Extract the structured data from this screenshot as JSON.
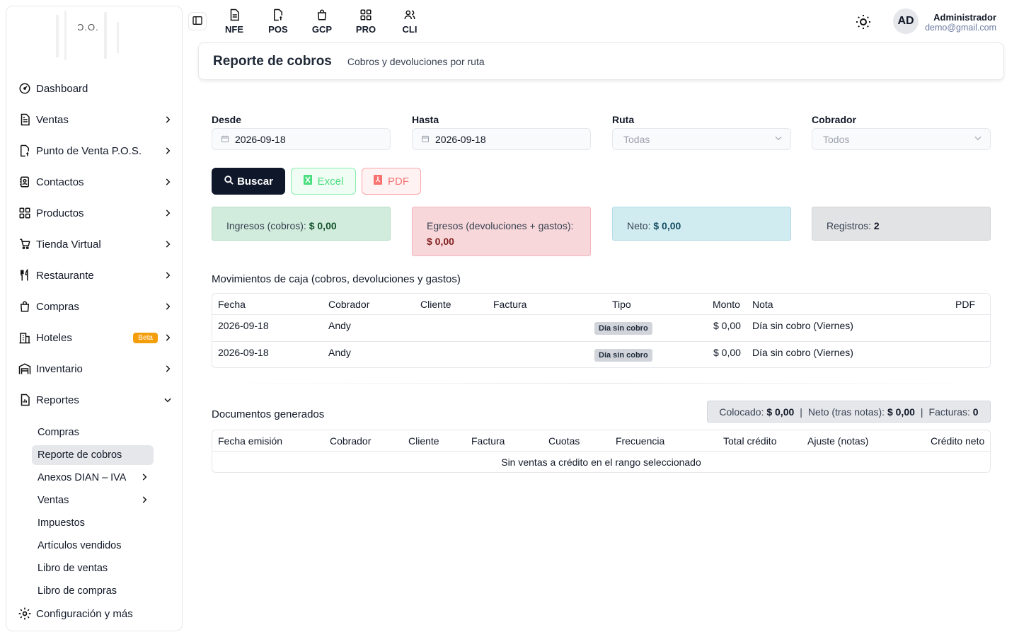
{
  "logo": {
    "text": "Ɔ.O."
  },
  "sidebar": {
    "items": [
      {
        "label": "Dashboard",
        "icon": "gauge-icon"
      },
      {
        "label": "Ventas",
        "icon": "document-icon"
      },
      {
        "label": "Punto de Venta P.O.S.",
        "icon": "pos-document-icon"
      },
      {
        "label": "Contactos",
        "icon": "contacts-book-icon"
      },
      {
        "label": "Productos",
        "icon": "grid-icon"
      },
      {
        "label": "Tienda Virtual",
        "icon": "cart-icon"
      },
      {
        "label": "Restaurante",
        "icon": "utensils-icon"
      },
      {
        "label": "Compras",
        "icon": "shopping-bag-icon"
      },
      {
        "label": "Hoteles",
        "icon": "building-icon",
        "badge": "Beta"
      },
      {
        "label": "Inventario",
        "icon": "warehouse-icon"
      },
      {
        "label": "Reportes",
        "icon": "report-icon"
      }
    ],
    "reportes_sub": [
      {
        "label": "Compras"
      },
      {
        "label": "Reporte de cobros"
      },
      {
        "label": "Anexos DIAN – IVA"
      },
      {
        "label": "Ventas"
      },
      {
        "label": "Impuestos"
      },
      {
        "label": "Artículos vendidos"
      },
      {
        "label": "Libro de ventas"
      },
      {
        "label": "Libro de compras"
      }
    ],
    "config": {
      "label": "Configuración y más",
      "icon": "gear-icon"
    }
  },
  "topnav": [
    {
      "label": "NFE",
      "icon": "file-icon"
    },
    {
      "label": "POS",
      "icon": "pos-file-icon"
    },
    {
      "label": "GCP",
      "icon": "bag-icon"
    },
    {
      "label": "PRO",
      "icon": "grid-icon"
    },
    {
      "label": "CLI",
      "icon": "users-icon"
    }
  ],
  "user": {
    "initials": "AD",
    "name": "Administrador",
    "email": "demo@gmail.com"
  },
  "header": {
    "title": "Reporte de cobros",
    "subtitle": "Cobros y devoluciones por ruta"
  },
  "filters": {
    "desde": {
      "label": "Desde",
      "value": "2026-09-18"
    },
    "hasta": {
      "label": "Hasta",
      "value": "2026-09-18"
    },
    "ruta": {
      "label": "Ruta",
      "value": "Todas"
    },
    "cobrador": {
      "label": "Cobrador",
      "value": "Todos"
    }
  },
  "buttons": {
    "buscar": "Buscar",
    "excel": "Excel",
    "pdf": "PDF"
  },
  "summary": {
    "ingresos_label": "Ingresos (cobros):",
    "ingresos_value": "$ 0,00",
    "egresos_label": "Egresos (devoluciones + gastos):",
    "egresos_value": "$ 0,00",
    "neto_label": "Neto:",
    "neto_value": "$ 0,00",
    "registros_label": "Registros:",
    "registros_value": "2"
  },
  "movimientos": {
    "title": "Movimientos de caja (cobros, devoluciones y gastos)",
    "headers": {
      "fecha": "Fecha",
      "cobrador": "Cobrador",
      "cliente": "Cliente",
      "factura": "Factura",
      "tipo": "Tipo",
      "monto": "Monto",
      "nota": "Nota",
      "pdf": "PDF"
    },
    "rows": [
      {
        "fecha": "2026-09-18",
        "cobrador": "Andy",
        "cliente": "",
        "factura": "",
        "tipo": "Día sin cobro",
        "monto": "$ 0,00",
        "nota": "Día sin cobro (Viernes)"
      },
      {
        "fecha": "2026-09-18",
        "cobrador": "Andy",
        "cliente": "",
        "factura": "",
        "tipo": "Día sin cobro",
        "monto": "$ 0,00",
        "nota": "Día sin cobro (Viernes)"
      }
    ]
  },
  "documentos": {
    "title": "Documentos generados",
    "colocado_label": "Colocado:",
    "colocado_value": "$ 0,00",
    "neto_label": "Neto (tras notas):",
    "neto_value": "$ 0,00",
    "facturas_label": "Facturas:",
    "facturas_value": "0",
    "headers": {
      "fecha": "Fecha emisión",
      "cobrador": "Cobrador",
      "cliente": "Cliente",
      "factura": "Factura",
      "cuotas": "Cuotas",
      "frecuencia": "Frecuencia",
      "total": "Total crédito",
      "ajuste": "Ajuste (notas)",
      "neto": "Crédito neto"
    },
    "empty": "Sin ventas a crédito en el rango seleccionado"
  }
}
